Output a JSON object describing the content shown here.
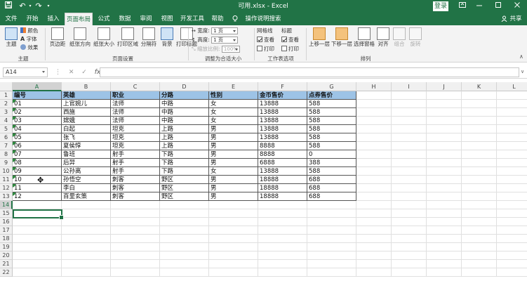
{
  "titlebar": {
    "title": "可用.xlsx - Excel",
    "login_label": "登录",
    "save_icon": "save-icon",
    "undo_icon": "undo-icon",
    "redo_icon": "redo-icon",
    "customize_icon": "customize-qat-icon",
    "ribbon_display_icon": "ribbon-display-options-icon",
    "minimize_icon": "minimize-icon",
    "maximize_icon": "maximize-icon",
    "close_icon": "close-icon"
  },
  "tabs": {
    "file": "文件",
    "home": "开始",
    "insert": "插入",
    "page_layout": "页面布局",
    "formulas": "公式",
    "data": "数据",
    "review": "审阅",
    "view": "视图",
    "developer": "开发工具",
    "help": "帮助",
    "tell_me": "操作说明搜索",
    "share": "共享",
    "active": "页面布局"
  },
  "ribbon": {
    "themes": {
      "theme": "主题",
      "colors": "颜色",
      "fonts": "字体",
      "effects": "效果",
      "group": "主题"
    },
    "page_setup": {
      "margins": "页边距",
      "orientation": "纸张方向",
      "size": "纸张大小",
      "print_area": "打印区域",
      "breaks": "分隔符",
      "background": "背景",
      "print_titles": "打印标题",
      "group": "页面设置"
    },
    "scale": {
      "width_label": "宽度:",
      "width_value": "1 页",
      "height_label": "高度:",
      "height_value": "1 页",
      "scale_label": "缩放比例:",
      "scale_value": "100%",
      "group": "调整为合适大小"
    },
    "sheet_options": {
      "gridlines": "网格线",
      "headings": "标题",
      "view": "查看",
      "print": "打印",
      "group": "工作表选项"
    },
    "arrange": {
      "bring_forward": "上移一层",
      "send_backward": "下移一层",
      "selection_pane": "选择窗格",
      "align": "对齐",
      "group_btn": "组合",
      "rotate": "旋转",
      "group": "排列"
    }
  },
  "formula_bar": {
    "name_box": "A14",
    "fx": "fx",
    "value": ""
  },
  "columns": [
    "A",
    "B",
    "C",
    "D",
    "E",
    "F",
    "G",
    "H",
    "I",
    "J",
    "K",
    "L"
  ],
  "rows": [
    "1",
    "2",
    "3",
    "4",
    "5",
    "6",
    "7",
    "8",
    "9",
    "10",
    "11",
    "12",
    "13",
    "14",
    "15",
    "16",
    "17",
    "18",
    "19",
    "20",
    "21",
    "22"
  ],
  "table": {
    "headers": [
      "编号",
      "英雄",
      "职业",
      "分路",
      "性别",
      "金币售价",
      "点券售价"
    ],
    "data": [
      [
        "01",
        "上官婉儿",
        "法师",
        "中路",
        "女",
        "13888",
        "588"
      ],
      [
        "02",
        "西施",
        "法师",
        "中路",
        "女",
        "13888",
        "588"
      ],
      [
        "03",
        "嫦娥",
        "法师",
        "中路",
        "女",
        "13888",
        "588"
      ],
      [
        "04",
        "白起",
        "坦克",
        "上路",
        "男",
        "13888",
        "588"
      ],
      [
        "05",
        "张飞",
        "坦克",
        "上路",
        "男",
        "13888",
        "588"
      ],
      [
        "06",
        "夏侯惇",
        "坦克",
        "上路",
        "男",
        "8888",
        "588"
      ],
      [
        "07",
        "鲁班",
        "射手",
        "下路",
        "男",
        "8888",
        "0"
      ],
      [
        "08",
        "后羿",
        "射手",
        "下路",
        "男",
        "6888",
        "388"
      ],
      [
        "09",
        "公孙离",
        "射手",
        "下路",
        "女",
        "13888",
        "588"
      ],
      [
        "10",
        "孙悟空",
        "刺客",
        "野区",
        "男",
        "18888",
        "688"
      ],
      [
        "11",
        "李白",
        "刺客",
        "野区",
        "男",
        "18888",
        "688"
      ],
      [
        "12",
        "百里玄策",
        "刺客",
        "野区",
        "男",
        "18888",
        "688"
      ]
    ]
  },
  "selection": {
    "cell": "A14",
    "header_fill": "#9dc3e6",
    "accent": "#217346"
  }
}
